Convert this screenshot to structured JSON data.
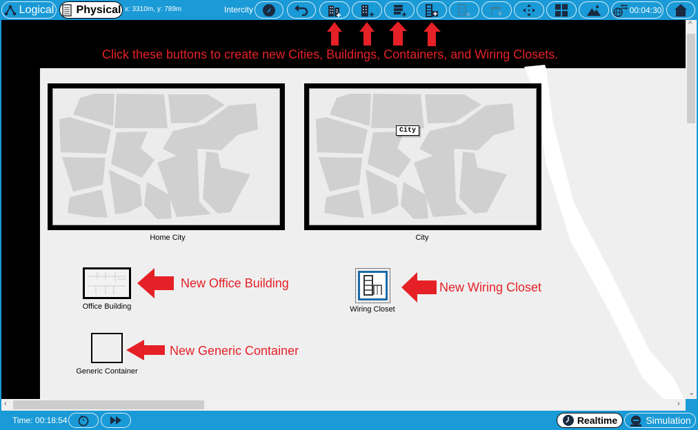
{
  "topbar": {
    "logical_label": "Logical",
    "physical_label": "Physical",
    "coords": "x: 3310m, y: 789m",
    "intercity_label": "Intercity",
    "buttons": [
      {
        "name": "navigation-button",
        "icon": "compass-icon"
      },
      {
        "name": "back-button",
        "icon": "back-arrow-icon"
      },
      {
        "name": "new-city-button",
        "icon": "new-city-icon"
      },
      {
        "name": "new-building-button",
        "icon": "new-building-icon"
      },
      {
        "name": "new-generic-container-button",
        "icon": "new-container-icon"
      },
      {
        "name": "new-wiring-closet-button",
        "icon": "new-wiring-closet-icon"
      },
      {
        "name": "new-rack-button",
        "icon": "new-rack-icon"
      },
      {
        "name": "new-table-button",
        "icon": "new-table-icon"
      },
      {
        "name": "move-object-button",
        "icon": "move-icon"
      },
      {
        "name": "grid-button",
        "icon": "grid-icon"
      },
      {
        "name": "background-image-button",
        "icon": "landscape-image-icon"
      },
      {
        "name": "network-timer-button",
        "icon": "globe-transfer-icon"
      },
      {
        "name": "home-button",
        "icon": "home-icon"
      }
    ],
    "timer": "00:04:30"
  },
  "annotations": {
    "toolbar_hint": "Click these buttons to create new Cities, Buildings, Containers, and Wiring Closets.",
    "office_building_hint": "New Office Building",
    "wiring_closet_hint": "New Wiring Closet",
    "generic_container_hint": "New Generic Container",
    "color": "#e52127"
  },
  "workspace": {
    "cities": [
      {
        "label": "Home City"
      },
      {
        "label": "City",
        "tooltip": "City"
      }
    ],
    "objects": [
      {
        "label": "Office Building"
      },
      {
        "label": "Wiring Closet"
      },
      {
        "label": "Generic Container"
      }
    ]
  },
  "bottombar": {
    "time": "Time: 00:18:54",
    "realtime_label": "Realtime",
    "simulation_label": "Simulation"
  }
}
